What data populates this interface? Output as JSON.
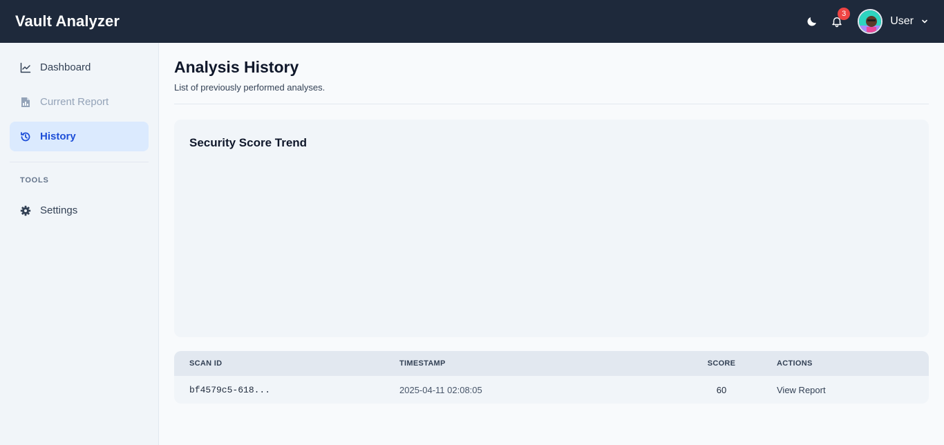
{
  "app": {
    "title": "Vault Analyzer"
  },
  "topbar": {
    "theme_icon": "moon-icon",
    "notifications_icon": "bell-icon",
    "notifications_count": "3",
    "user_name": "User",
    "user_menu_icon": "chevron-down-icon"
  },
  "sidebar": {
    "items": [
      {
        "label": "Dashboard",
        "icon": "line-chart-icon",
        "state": "normal"
      },
      {
        "label": "Current Report",
        "icon": "file-icon",
        "state": "disabled"
      },
      {
        "label": "History",
        "icon": "history-icon",
        "state": "active"
      }
    ],
    "tools_label": "TOOLS",
    "tools_items": [
      {
        "label": "Settings",
        "icon": "gear-icon"
      }
    ]
  },
  "page": {
    "title": "Analysis History",
    "subtitle": "List of previously performed analyses."
  },
  "chart": {
    "title": "Security Score Trend"
  },
  "table": {
    "headers": [
      "SCAN ID",
      "TIMESTAMP",
      "SCORE",
      "ACTIONS"
    ],
    "rows": [
      {
        "scan_id": "bf4579c5-618...",
        "timestamp": "2025-04-11 02:08:05",
        "score": "60",
        "action": "View Report"
      }
    ]
  },
  "colors": {
    "topbar": "#1e293b",
    "accent": "#1d4ed8",
    "active_bg": "#dbeafe",
    "badge": "#ef4444"
  }
}
